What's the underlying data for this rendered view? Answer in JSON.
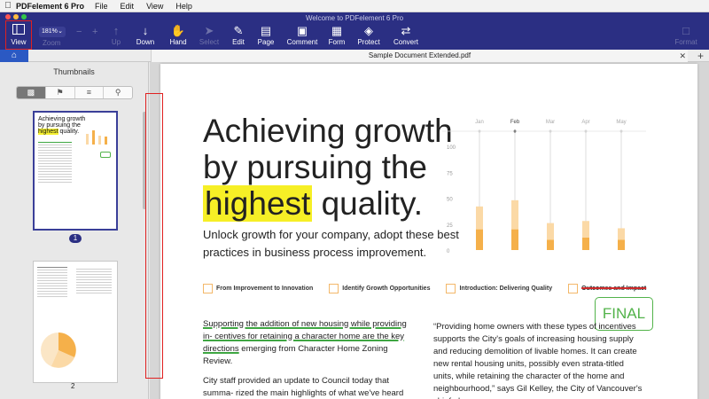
{
  "menubar": {
    "apple": "",
    "app_name": "PDFelement 6 Pro",
    "items": [
      "File",
      "Edit",
      "View",
      "Help"
    ]
  },
  "window": {
    "title": "Welcome to PDFelement 6 Pro"
  },
  "toolbar": {
    "view": "View",
    "zoom_value": "181%",
    "zoom_label": "Zoom",
    "up": "Up",
    "down": "Down",
    "hand": "Hand",
    "select": "Select",
    "edit": "Edit",
    "page": "Page",
    "comment": "Comment",
    "form": "Form",
    "protect": "Protect",
    "convert": "Convert",
    "format": "Format"
  },
  "tab": {
    "title": "Sample Document Extended.pdf"
  },
  "sidebar": {
    "title": "Thumbnails",
    "page1": "1",
    "page2": "2",
    "thumb1_title_a": "Achieving growth",
    "thumb1_title_b": "by pursuing the",
    "thumb1_title_hl": "highest",
    "thumb1_title_c": "quality."
  },
  "document": {
    "headline_1": "Achieving growth",
    "headline_2": "by pursuing the",
    "headline_hl": "highest",
    "headline_3": "quality.",
    "lead": "Unlock growth for your company, adopt these best practices in business process improvement.",
    "tags": [
      "From Improvement to Innovation",
      "Identify Growth Opportunities",
      "Introduction: Delivering Quality",
      "Outcomes and Impact"
    ],
    "col1_underlined": "Supporting the addition of new housing while providing in- centives for retaining a character home are the key directions",
    "col1_rest": " emerging from Character Home Zoning Review.",
    "col1_p2": "City staff provided an update to Council today that summa- rized the main highlights of what we've heard through recent",
    "col2": "“Providing home owners with these types of incentives supports the City's goals of increasing housing supply and reducing demolition of livable homes.  It can create new rental housing units, possibly even strata-titled units, while retaining the character of the home and neighbourhood,” says Gil Kelley, the City of Vancouver's chief planner.",
    "stamp": "FINAL"
  },
  "chart_data": {
    "type": "bar",
    "categories": [
      "Jan",
      "Feb",
      "Mar",
      "Apr",
      "May"
    ],
    "yticks": [
      0,
      25,
      50,
      75,
      100
    ],
    "ylim": [
      0,
      100
    ],
    "series": [
      {
        "values": [
          20,
          20,
          10,
          12,
          10
        ]
      },
      {
        "values": [
          22,
          28,
          16,
          16,
          11
        ]
      }
    ],
    "colors": [
      "#f5b04a",
      "#fbd9a6"
    ]
  }
}
